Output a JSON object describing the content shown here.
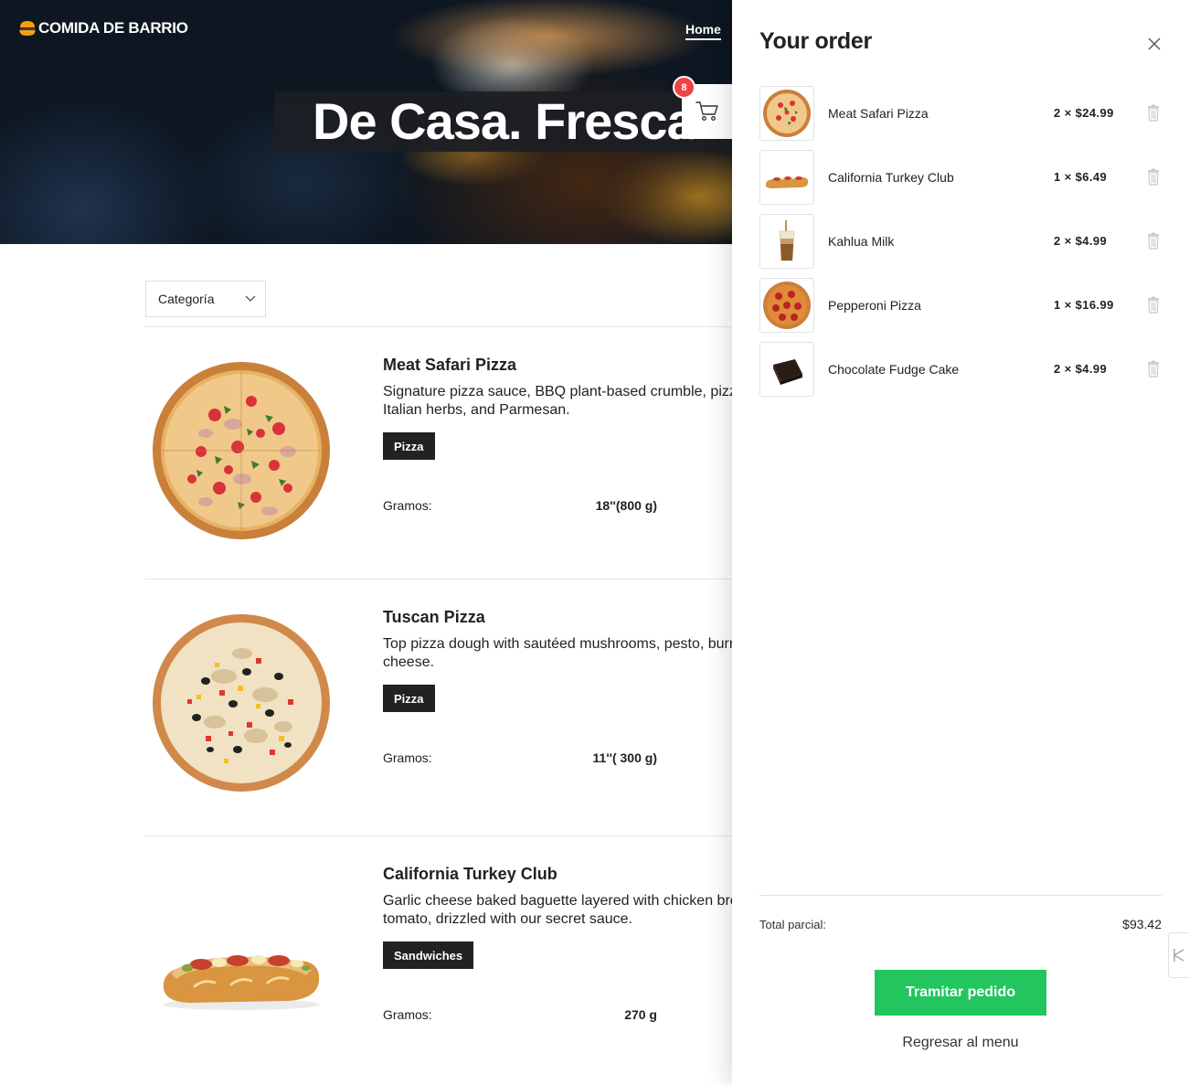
{
  "header": {
    "logo_text": "COMIDA DE BARRIO",
    "nav_home": "Home",
    "hero_title": "De Casa. Fresca. Ya.",
    "cart_count": "8"
  },
  "filter": {
    "category_label": "Categoría"
  },
  "products": [
    {
      "name": "Meat Safari Pizza",
      "description": "Signature pizza sauce, BBQ plant-based crumble, pizza mozzarella, red pepper, Italian herbs, and Parmesan.",
      "tag": "Pizza",
      "weight_label": "Gramos:",
      "weight": "18''(800 g)"
    },
    {
      "name": "Tuscan Pizza",
      "description": "Top pizza dough with sautéed mushrooms, pesto, burrata, mozzarella and soft goat cheese.",
      "tag": "Pizza",
      "weight_label": "Gramos:",
      "weight": "11''( 300 g)"
    },
    {
      "name": "California Turkey Club",
      "description": "Garlic cheese baked baguette layered with chicken breast, bacon, lettuce and fresh tomato, drizzled with our secret sauce.",
      "tag": "Sandwiches",
      "weight_label": "Gramos:",
      "weight": "270 g"
    }
  ],
  "order": {
    "title": "Your order",
    "items": [
      {
        "name": "Meat Safari Pizza",
        "qty_price": "2 × $24.99"
      },
      {
        "name": "California Turkey Club",
        "qty_price": "1 × $6.49"
      },
      {
        "name": "Kahlua Milk",
        "qty_price": "2 × $4.99"
      },
      {
        "name": "Pepperoni Pizza",
        "qty_price": "1 × $16.99"
      },
      {
        "name": "Chocolate Fudge Cake",
        "qty_price": "2 × $4.99"
      }
    ],
    "subtotal_label": "Total parcial:",
    "subtotal_value": "$93.42",
    "checkout_label": "Tramitar pedido",
    "back_label": "Regresar al menu"
  },
  "colors": {
    "accent_green": "#22c55e",
    "badge_red": "#ef4444",
    "tag_dark": "#222222"
  }
}
